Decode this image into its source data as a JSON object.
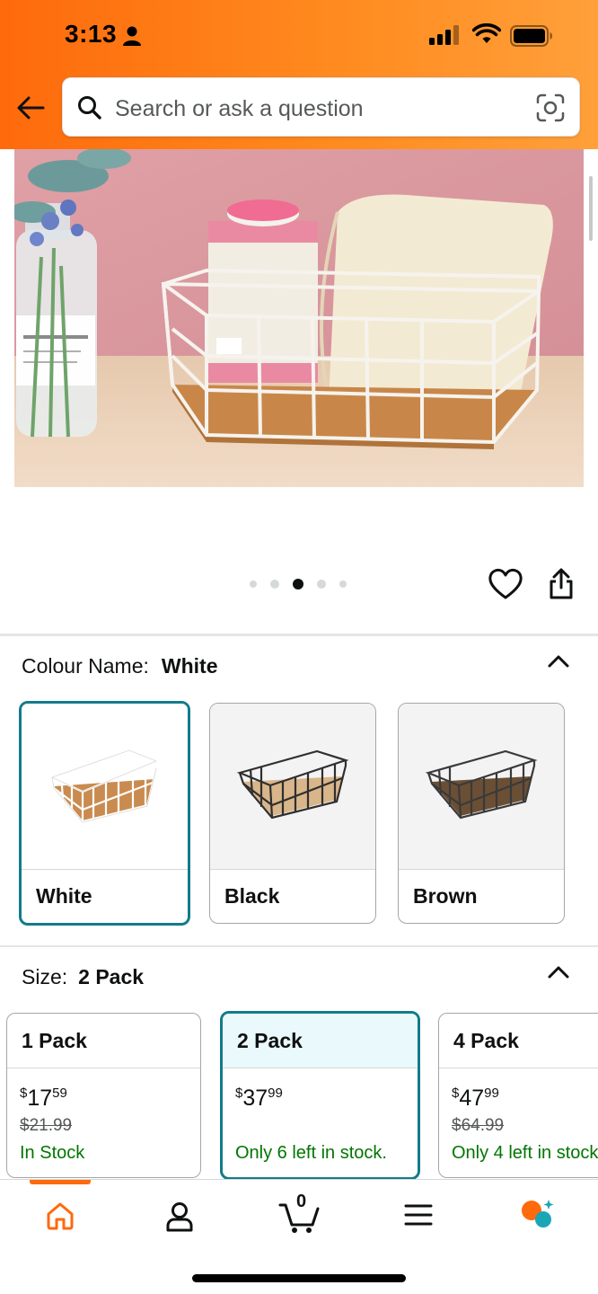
{
  "status_bar": {
    "time": "3:13"
  },
  "search": {
    "placeholder": "Search or ask a question"
  },
  "carousel": {
    "total_images": 5,
    "active_index": 3
  },
  "colour": {
    "label": "Colour Name:",
    "selected": "White",
    "options": [
      {
        "name": "White",
        "selected": true
      },
      {
        "name": "Black",
        "selected": false
      },
      {
        "name": "Brown",
        "selected": false
      }
    ]
  },
  "size": {
    "label": "Size:",
    "selected": "2 Pack",
    "options": [
      {
        "name": "1 Pack",
        "currency": "$",
        "dollars": "17",
        "cents": "59",
        "was": "$21.99",
        "stock": "In Stock",
        "selected": false
      },
      {
        "name": "2 Pack",
        "currency": "$",
        "dollars": "37",
        "cents": "99",
        "was": "",
        "stock": "Only 6 left in stock.",
        "selected": true
      },
      {
        "name": "4 Pack",
        "currency": "$",
        "dollars": "47",
        "cents": "99",
        "was": "$64.99",
        "stock": "Only 4 left in stock.",
        "selected": false
      }
    ]
  },
  "bottom_nav": {
    "cart_count": "0",
    "items": [
      "home-icon",
      "account-icon",
      "cart-icon",
      "menu-icon",
      "rufus-icon"
    ]
  },
  "colors": {
    "accent": "#fe6a0c",
    "selected_border": "#137b8b",
    "in_stock": "#007600"
  }
}
